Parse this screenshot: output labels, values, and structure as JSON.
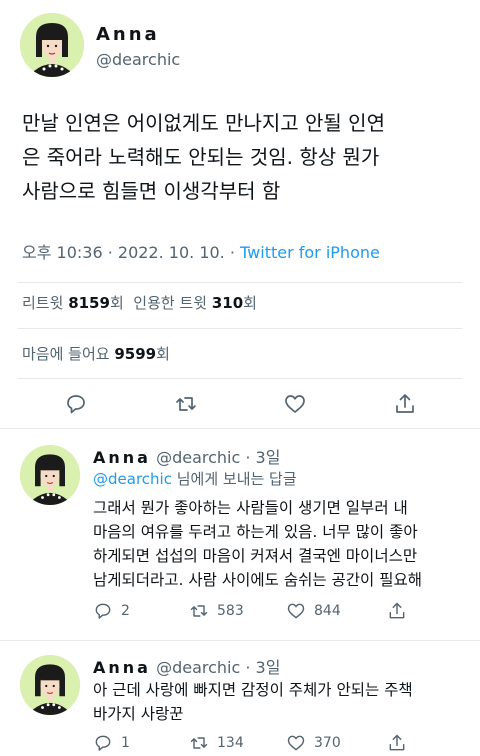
{
  "main_tweet": {
    "author_name": "Anna",
    "handle": "@dearchic",
    "text_lines": [
      "만날 인연은 어이없게도 만나지고 안될 인연",
      "은 죽어라 노력해도 안되는 것임. 항상 뭔가",
      "사람으로 힘들면 이생각부터 함"
    ],
    "time": "오후 10:36 · 2022. 10. 10. · ",
    "source": "Twitter for iPhone",
    "retweets_label": "리트윗",
    "retweets": "8159",
    "retweets_unit": "회",
    "quotes_label": "인용한 트윗",
    "quotes": "310",
    "quotes_unit": "회",
    "likes_label": "마음에 들어요",
    "likes": "9599",
    "likes_unit": "회",
    "actions": [
      "reply-icon",
      "retweet-icon",
      "heart-icon",
      "share-icon"
    ]
  },
  "replies": [
    {
      "author_name": "Anna",
      "handle_time": "@dearchic · 3일",
      "reply_to_mention": "@dearchic",
      "reply_to_suffix": " 님에게 보내는 답글",
      "text_lines": [
        "그래서 뭔가 좋아하는 사람들이 생기면 일부러 내",
        "마음의 여유를 두려고 하는게 있음. 너무 많이 좋아",
        "하게되면 섭섭의 마음이 커져서 결국엔 마이너스만",
        "남게되더라고. 사람 사이에도 숨쉬는 공간이 필요해"
      ],
      "replies": "2",
      "retweets": "583",
      "likes": "844"
    },
    {
      "author_name": "Anna",
      "handle_time": "@dearchic · 3일",
      "text_lines": [
        "아 근데 사랑에 빠지면 감정이 주체가 안되는 주책",
        "바가지 사랑꾼"
      ],
      "replies": "1",
      "retweets": "134",
      "likes": "370"
    }
  ],
  "colors": {
    "link": "#1d9bf0",
    "secondary_text": "#536471",
    "avatar_bg": "#d9f0ae",
    "divider": "#e6e9ec"
  }
}
